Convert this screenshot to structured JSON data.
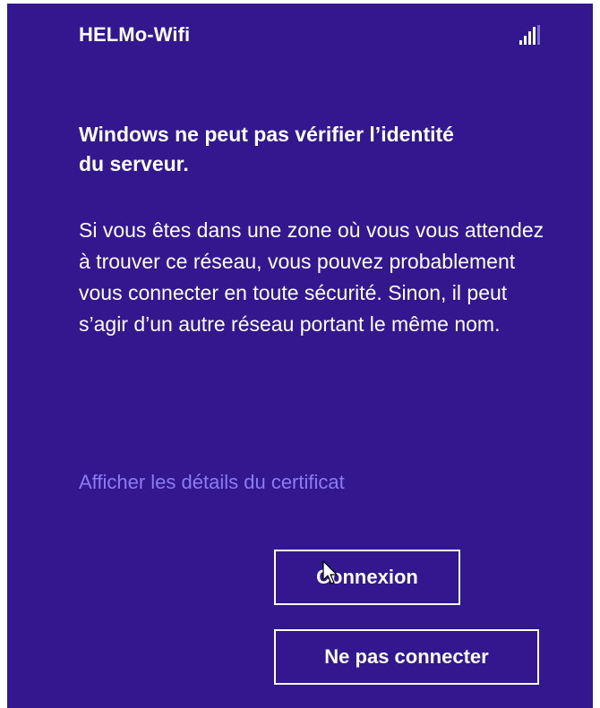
{
  "network": {
    "name": "HELMo-Wifi",
    "signal_icon": "signal-strength-icon"
  },
  "message": {
    "title": "Windows ne peut pas vérifier l’identité du serveur.",
    "body": "Si vous êtes dans une zone où vous vous attendez à trouver ce réseau, vous pouvez probablement vous connecter en toute sécurité. Sinon, il peut s’agir d’un autre réseau portant le même nom."
  },
  "links": {
    "show_certificate": "Afficher les détails du certificat"
  },
  "buttons": {
    "connect": "Connexion",
    "dont_connect": "Ne pas connecter"
  },
  "colors": {
    "background": "#32178f",
    "link": "#8b7cf4",
    "text": "#ffffff"
  }
}
